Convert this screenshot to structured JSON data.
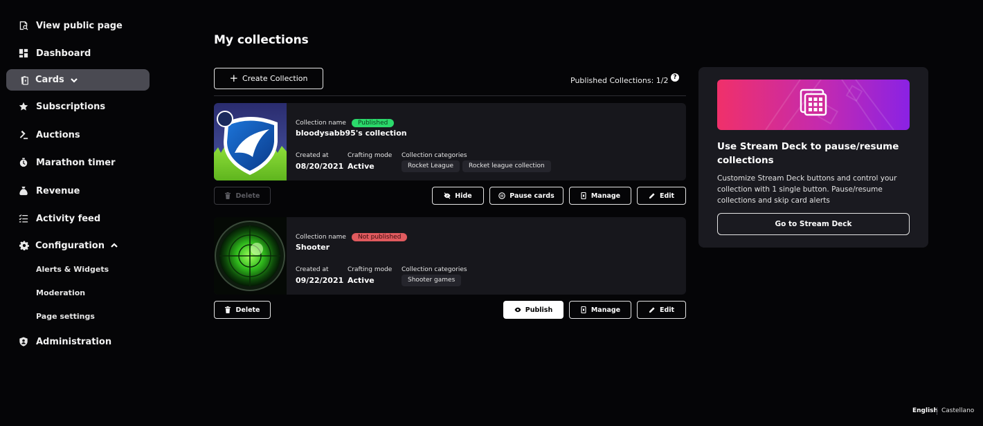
{
  "sidebar": {
    "items": [
      {
        "label": "View public page",
        "icon": "search-page-icon"
      },
      {
        "label": "Dashboard",
        "icon": "dashboard-icon"
      },
      {
        "label": "Cards",
        "icon": "cards-icon",
        "active": true,
        "expanded": false
      },
      {
        "label": "Subscriptions",
        "icon": "star-icon"
      },
      {
        "label": "Auctions",
        "icon": "gavel-icon"
      },
      {
        "label": "Marathon timer",
        "icon": "timer-icon"
      },
      {
        "label": "Revenue",
        "icon": "money-bag-icon"
      },
      {
        "label": "Activity feed",
        "icon": "list-icon"
      },
      {
        "label": "Configuration",
        "icon": "gear-icon",
        "expanded": true
      },
      {
        "label": "Administration",
        "icon": "shield-user-icon"
      }
    ],
    "config_subitems": [
      "Alerts & Widgets",
      "Moderation",
      "Page settings"
    ]
  },
  "main": {
    "title": "My collections",
    "create_label": "Create Collection",
    "published_count": "Published Collections: 1/2",
    "help": "?",
    "labels": {
      "collection_name": "Collection name",
      "created_at": "Created at",
      "crafting_mode": "Crafting mode",
      "collection_categories": "Collection categories"
    },
    "collections": [
      {
        "name": "bloodysabb95's collection",
        "status": "Published",
        "created_at": "08/20/2021",
        "crafting_mode": "Active",
        "categories": [
          "Rocket League",
          "Rocket league collection"
        ],
        "actions": {
          "delete": "Delete",
          "hide": "Hide",
          "pause": "Pause cards",
          "manage": "Manage",
          "edit": "Edit"
        }
      },
      {
        "name": "Shooter",
        "status": "Not published",
        "created_at": "09/22/2021",
        "crafting_mode": "Active",
        "categories": [
          "Shooter games"
        ],
        "actions": {
          "delete": "Delete",
          "publish": "Publish",
          "manage": "Manage",
          "edit": "Edit"
        }
      }
    ]
  },
  "stream_deck": {
    "title": "Use Stream Deck to pause/resume collections",
    "description": "Customize Stream Deck buttons and control your collection with 1 single button. Pause/resume collections and skip card alerts",
    "button": "Go to Stream Deck"
  },
  "languages": [
    "English",
    "Castellano"
  ],
  "colors": {
    "background": "#050507",
    "card": "#17171c",
    "published": "#2bd96b",
    "not_published": "#e05a5e",
    "banner_start": "#f0306a",
    "banner_end": "#8a22e4"
  }
}
